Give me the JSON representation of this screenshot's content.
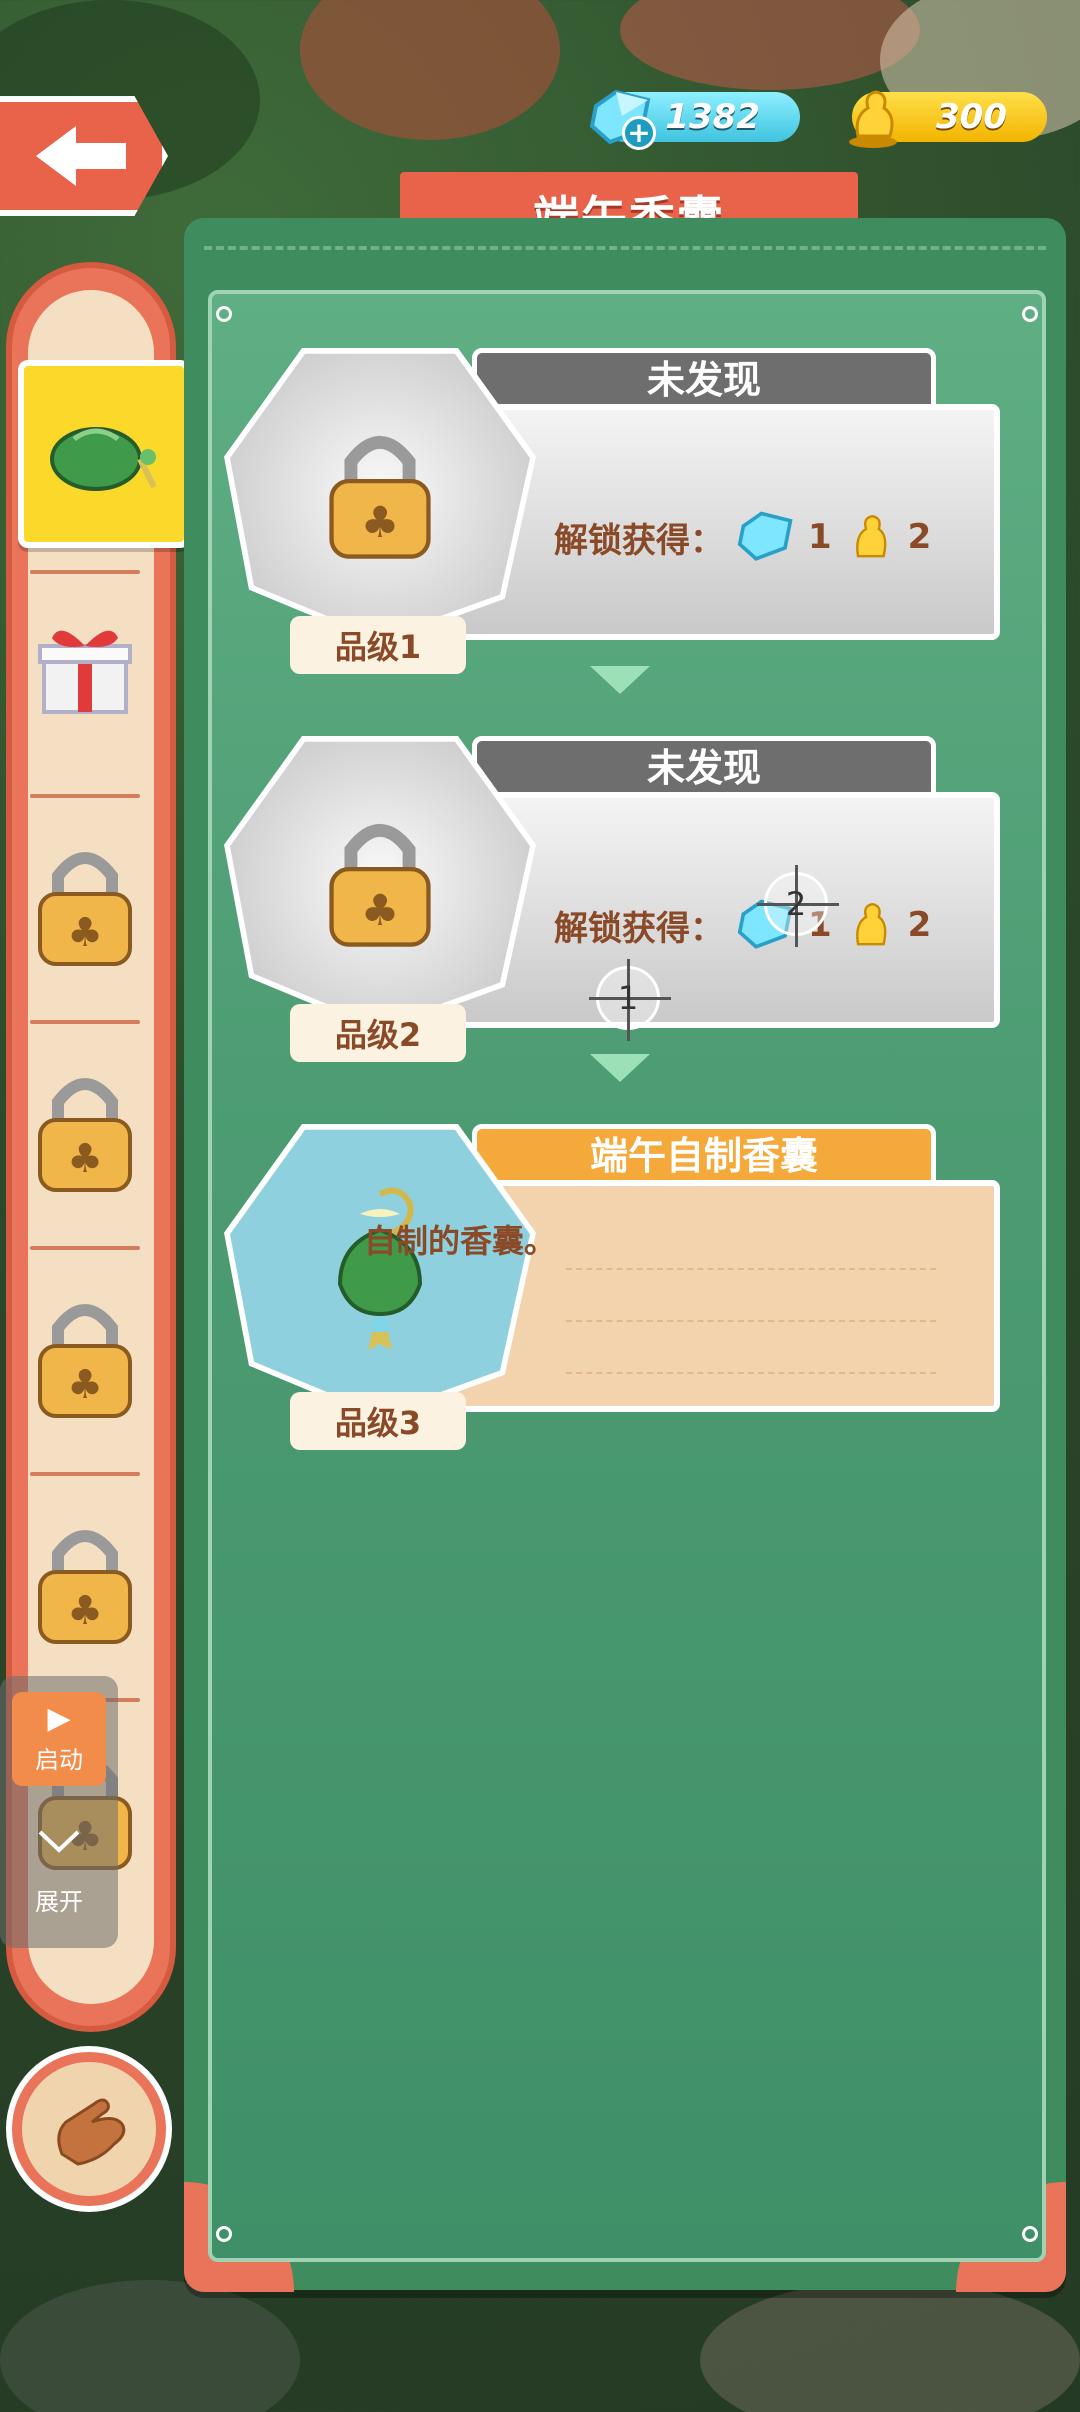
{
  "header": {
    "back_icon": "back-arrow-icon",
    "gems": "1382",
    "gold": "300",
    "title": "端午香囊"
  },
  "sidebar": {
    "items": [
      {
        "icon": "sachet-icon",
        "selected": true
      },
      {
        "icon": "gift-box-icon",
        "selected": false
      },
      {
        "icon": "lock-icon",
        "selected": false
      },
      {
        "icon": "lock-icon",
        "selected": false
      },
      {
        "icon": "lock-icon",
        "selected": false
      },
      {
        "icon": "lock-icon",
        "selected": false
      },
      {
        "icon": "lock-icon",
        "selected": false
      }
    ]
  },
  "float_control": {
    "start_label": "启动",
    "expand_label": "展开"
  },
  "cards": [
    {
      "status": "未发现",
      "reward_label": "解锁获得：",
      "gem_reward": "1",
      "gold_reward": "2",
      "grade": "品级1",
      "icon": "lock-icon"
    },
    {
      "status": "未发现",
      "reward_label": "解锁获得：",
      "gem_reward": "1",
      "gold_reward": "2",
      "grade": "品级2",
      "icon": "lock-icon"
    },
    {
      "status": "端午自制香囊",
      "description": "自制的香囊。",
      "grade": "品级3",
      "icon": "sachet-icon"
    }
  ],
  "markers": [
    "1",
    "2"
  ],
  "colors": {
    "panel_green": "#3f8d5f",
    "accent_orange": "#e9624a",
    "gold": "#f2b400",
    "gem": "#3fc3e0"
  }
}
